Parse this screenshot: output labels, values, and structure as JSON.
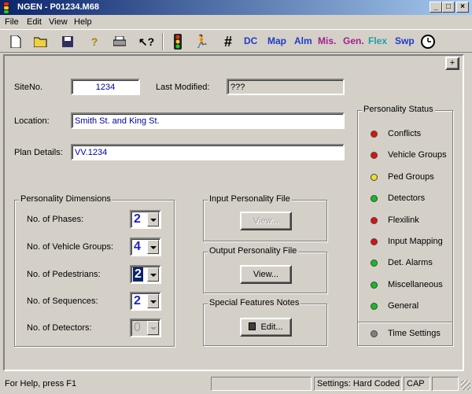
{
  "window": {
    "title": "NGEN - P01234.M68"
  },
  "menu": [
    "File",
    "Edit",
    "View",
    "Help"
  ],
  "toolbar": {
    "text_buttons": [
      {
        "label": "DC",
        "color": "#1e3cc8"
      },
      {
        "label": "Map",
        "color": "#1e3cc8"
      },
      {
        "label": "Alm",
        "color": "#1e3cc8"
      },
      {
        "label": "Mis.",
        "color": "#a0208c"
      },
      {
        "label": "Gen.",
        "color": "#a0208c"
      },
      {
        "label": "Flex",
        "color": "#1ea0a0"
      },
      {
        "label": "Swp",
        "color": "#1e3cc8"
      }
    ]
  },
  "form": {
    "expand_button": "+",
    "site_no_label": "SiteNo.",
    "site_no_value": "1234",
    "last_modified_label": "Last Modified:",
    "last_modified_value": "???",
    "location_label": "Location:",
    "location_value": "Smith St. and King St.",
    "plan_details_label": "Plan Details:",
    "plan_details_value": "VV.1234"
  },
  "dimensions": {
    "title": "Personality Dimensions",
    "rows": [
      {
        "label": "No. of Phases:",
        "value": "2"
      },
      {
        "label": "No. of Vehicle Groups:",
        "value": "4"
      },
      {
        "label": "No. of Pedestrians:",
        "value": "2"
      },
      {
        "label": "No. of Sequences:",
        "value": "2"
      },
      {
        "label": "No. of Detectors:",
        "value": "0"
      }
    ]
  },
  "files": {
    "input_title": "Input Personality File",
    "input_button": "View...",
    "output_title": "Output Personality File",
    "output_button": "View...",
    "notes_title": "Special Features Notes",
    "notes_button": "Edit..."
  },
  "status_panel": {
    "title": "Personality Status",
    "items": [
      {
        "label": "Conflicts",
        "color": "#e01010"
      },
      {
        "label": "Vehicle Groups",
        "color": "#e01010"
      },
      {
        "label": "Ped Groups",
        "color": "#f0e020"
      },
      {
        "label": "Detectors",
        "color": "#10c020"
      },
      {
        "label": "Flexilink",
        "color": "#e01010"
      },
      {
        "label": "Input Mapping",
        "color": "#e01010"
      },
      {
        "label": "Det. Alarms",
        "color": "#10c020"
      },
      {
        "label": "Miscellaneous",
        "color": "#10c020"
      },
      {
        "label": "General",
        "color": "#10c020"
      }
    ],
    "time_settings": {
      "label": "Time Settings",
      "color": "#808080"
    }
  },
  "statusbar": {
    "help": "For Help, press F1",
    "settings": "Settings: Hard Coded",
    "cap": "CAP"
  }
}
